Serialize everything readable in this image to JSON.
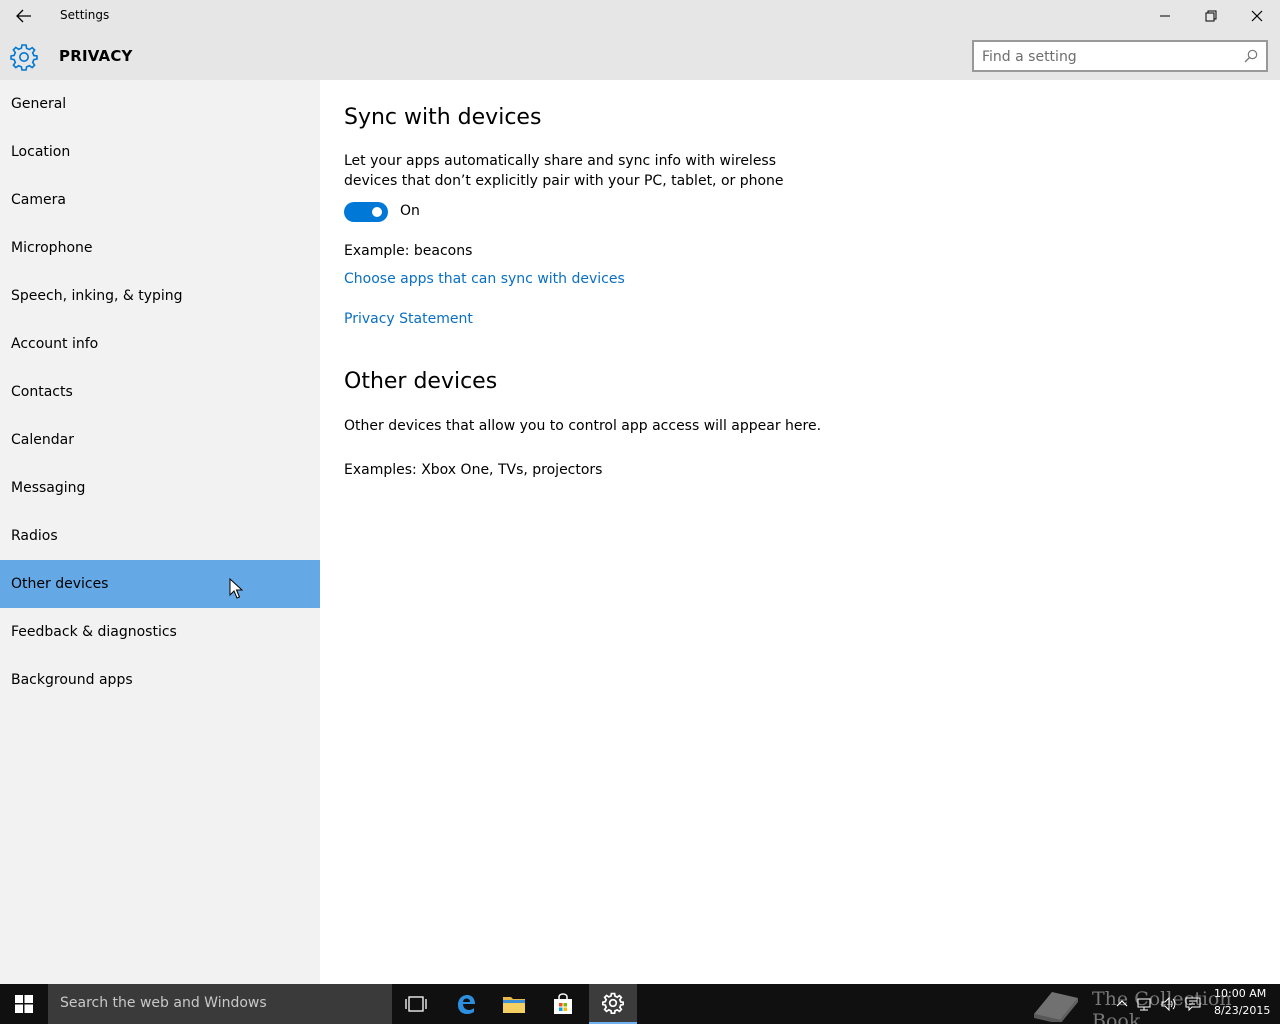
{
  "window": {
    "title": "Settings"
  },
  "header": {
    "section": "PRIVACY",
    "search_placeholder": "Find a setting"
  },
  "sidebar": {
    "items": [
      {
        "label": "General"
      },
      {
        "label": "Location"
      },
      {
        "label": "Camera"
      },
      {
        "label": "Microphone"
      },
      {
        "label": "Speech, inking, & typing"
      },
      {
        "label": "Account info"
      },
      {
        "label": "Contacts"
      },
      {
        "label": "Calendar"
      },
      {
        "label": "Messaging"
      },
      {
        "label": "Radios"
      },
      {
        "label": "Other devices",
        "selected": true
      },
      {
        "label": "Feedback & diagnostics"
      },
      {
        "label": "Background apps"
      }
    ]
  },
  "main": {
    "sync": {
      "heading": "Sync with devices",
      "description_line1": "Let your apps automatically share and sync info with wireless",
      "description_line2": "devices that don’t explicitly pair with your PC, tablet, or phone",
      "toggle_state": "On",
      "example": "Example: beacons",
      "choose_link": "Choose apps that can sync with devices",
      "privacy_link": "Privacy Statement"
    },
    "other": {
      "heading": "Other devices",
      "description": "Other devices that allow you to control app access will appear here.",
      "examples": "Examples: Xbox One, TVs, projectors"
    }
  },
  "taskbar": {
    "search_text": "Search the web and Windows",
    "time": "10:00 AM",
    "date": "8/23/2015",
    "watermark": "The Collection Book"
  },
  "colors": {
    "accent": "#0078d7",
    "selected_nav": "#64a8e5",
    "link": "#0a6fc2"
  }
}
